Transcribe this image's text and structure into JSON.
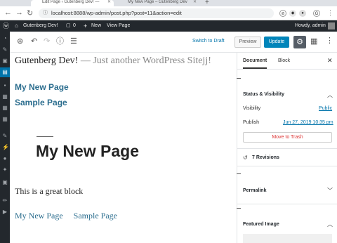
{
  "browser": {
    "tabs": [
      {
        "title": "Edit Page ‹ Gutenberg Dev! —"
      },
      {
        "title": "My New Page – Gutenberg Dev"
      }
    ],
    "url": "localhost:8888/wp-admin/post.php?post=11&action=edit",
    "profile_initial": "G"
  },
  "adminbar": {
    "site": "Gutenberg Dev!",
    "comments": "0",
    "new_label": "New",
    "view_label": "View Page",
    "howdy": "Howdy, admin"
  },
  "toolbar": {
    "switch_label": "Switch to Draft",
    "preview_label": "Preview",
    "update_label": "Update"
  },
  "content": {
    "site_title": "Gutenberg Dev!",
    "tagline": "— Just another WordPress Sitejj!",
    "nav_links": [
      "My New Page",
      "Sample Page"
    ],
    "page_title": "My New Page",
    "paragraph": "This is a great block",
    "footer_links": [
      "My New Page",
      "Sample Page"
    ]
  },
  "panel": {
    "tabs": [
      "Document",
      "Block"
    ],
    "status_heading": "Status & Visibility",
    "visibility_label": "Visibility",
    "visibility_value": "Public",
    "publish_label": "Publish",
    "publish_value": "Jun 27, 2019 10:35 pm",
    "trash_label": "Move to Trash",
    "revisions": "7 Revisions",
    "permalink": "Permalink",
    "featured_image": "Featured Image"
  },
  "colors": {
    "accent": "#0085ba",
    "adminbar": "#23282d",
    "link": "#2b6d8e",
    "danger": "#dc3232"
  }
}
